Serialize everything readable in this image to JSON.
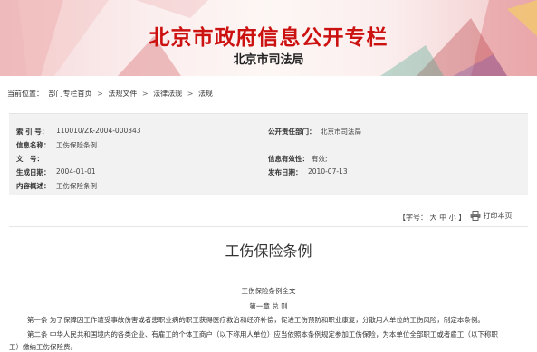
{
  "banner": {
    "title": "北京市政府信息公开专栏",
    "subtitle": "北京市司法局"
  },
  "breadcrumb": {
    "prefix": "当前位置：",
    "items": [
      "部门专栏首页",
      "法规文件",
      "法律法规",
      "法规"
    ],
    "separator": ">"
  },
  "meta": {
    "index_label": "索 引 号：",
    "index_value": "110010/ZK-2004-000343",
    "issuer_label": "公开责任部门：",
    "issuer_value": "北京市司法局",
    "name_label": "信息名称：",
    "name_value": "工伤保险条例",
    "doc_no_label": "文　号：",
    "doc_no_value": "",
    "validity_label": "信息有效性：",
    "validity_value": "有效;",
    "created_label": "生成日期：",
    "created_value": "2004-01-01",
    "published_label": "发布日期：",
    "published_value": "2010-07-13",
    "summary_label": "内容概述：",
    "summary_value": "工伤保险条例"
  },
  "tools": {
    "font_prefix": "【字号：",
    "font_large": "大",
    "font_medium": "中",
    "font_small": "小",
    "font_suffix": "】",
    "print_label": "打印本页"
  },
  "document": {
    "title": "工伤保险条例",
    "subtitle": "工伤保险条例全文",
    "chapter": "第一章 总 则",
    "para1": "第一条 为了保障因工作遭受事故伤害或者患职业病的职工获得医疗救治和经济补偿，促进工伤预防和职业康复，分散用人单位的工伤风险，制定本条例。",
    "para2_line1": "第二条 中华人民共和国境内的各类企业、有雇工的个体工商户（以下称用人单位）应当依照本条例规定参加工伤保险，为本单位全部职工或者雇工（以下称职",
    "para2_line2": "工）缴纳工伤保险费。"
  },
  "colors": {
    "banner_title": "#cc1111",
    "meta_background": "#f2f2f2"
  }
}
